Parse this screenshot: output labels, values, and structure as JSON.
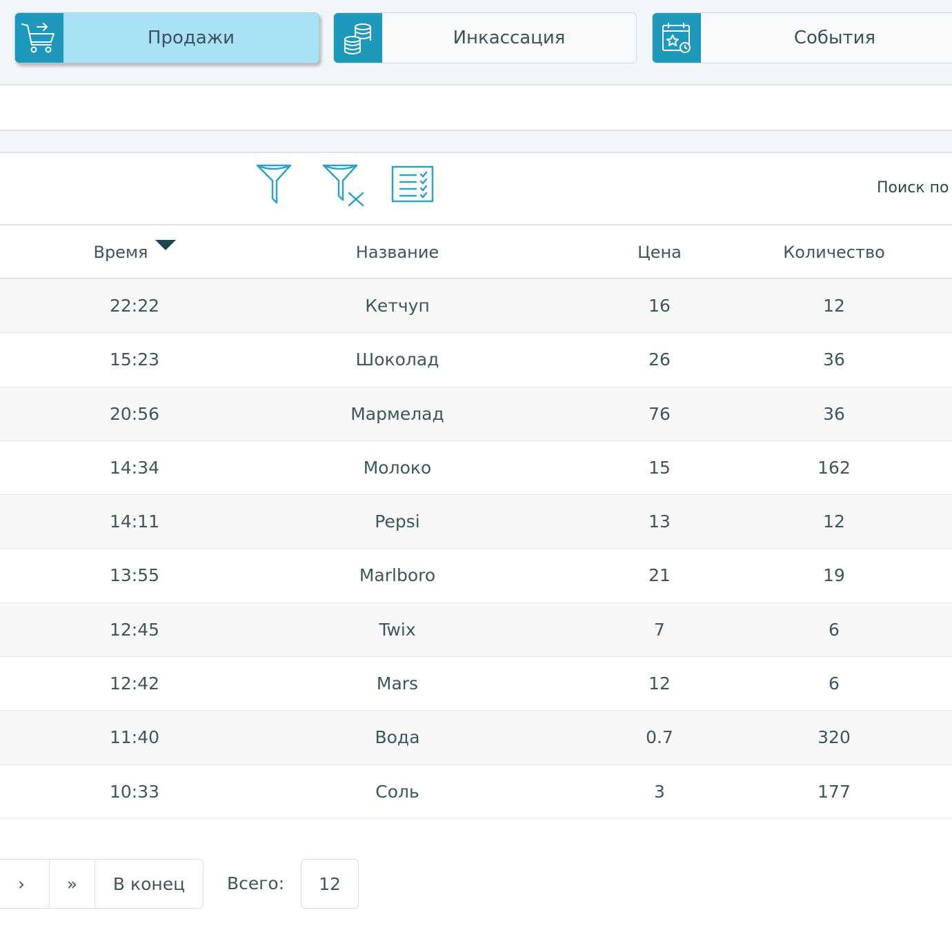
{
  "tabs": [
    {
      "label": "Продажи",
      "icon": "shopping-cart-icon",
      "active": true
    },
    {
      "label": "Инкассация",
      "icon": "coins-stack-icon",
      "active": false
    },
    {
      "label": "События",
      "icon": "calendar-event-icon",
      "active": false
    }
  ],
  "toolbar": {
    "filter_icon": "filter-icon",
    "clear_filter_icon": "filter-clear-icon",
    "columns_icon": "column-list-icon",
    "search_label": "Поиск по"
  },
  "table": {
    "columns": [
      "Время",
      "Название",
      "Цена",
      "Количество"
    ],
    "sort_column": "Время",
    "sort_direction": "desc",
    "rows": [
      {
        "time": "22:22",
        "name": "Кетчуп",
        "price": "16",
        "qty": "12"
      },
      {
        "time": "15:23",
        "name": "Шоколад",
        "price": "26",
        "qty": "36"
      },
      {
        "time": "20:56",
        "name": "Мармелад",
        "price": "76",
        "qty": "36"
      },
      {
        "time": "14:34",
        "name": "Молоко",
        "price": "15",
        "qty": "162"
      },
      {
        "time": "14:11",
        "name": "Pepsi",
        "price": "13",
        "qty": "12"
      },
      {
        "time": "13:55",
        "name": "Marlboro",
        "price": "21",
        "qty": "19"
      },
      {
        "time": "12:45",
        "name": "Twix",
        "price": "7",
        "qty": "6"
      },
      {
        "time": "12:42",
        "name": "Mars",
        "price": "12",
        "qty": "6"
      },
      {
        "time": "11:40",
        "name": "Вода",
        "price": "0.7",
        "qty": "320"
      },
      {
        "time": "10:33",
        "name": "Соль",
        "price": "3",
        "qty": "177"
      }
    ]
  },
  "pagination": {
    "next_label": "›",
    "last_arrow_label": "»",
    "to_end_label": "В конец",
    "total_label": "Всего:",
    "total_value": "12"
  },
  "colors": {
    "accent": "#1e98bb",
    "active_tab": "#a8e1f3",
    "text": "#3d5560",
    "icon_stroke": "#2aa3c6"
  }
}
